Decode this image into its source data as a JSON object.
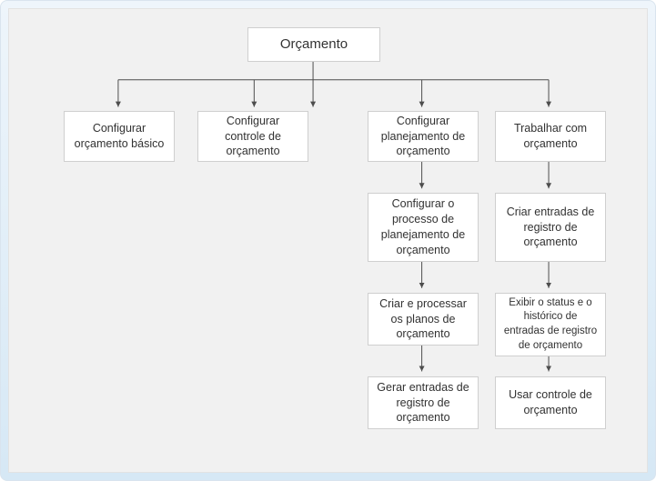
{
  "diagram": {
    "root": {
      "label": "Orçamento"
    },
    "row1": {
      "c1": {
        "label": "Configurar orçamento básico"
      },
      "c2": {
        "label": "Configurar controle de orçamento"
      },
      "c3": {
        "label": "Configurar planejamento de orçamento"
      },
      "c4": {
        "label": "Trabalhar com orçamento"
      }
    },
    "col3": {
      "n1": {
        "label": "Configurar o processo de planejamento de orçamento"
      },
      "n2": {
        "label": "Criar e processar os planos de orçamento"
      },
      "n3": {
        "label": "Gerar entradas de registro de orçamento"
      }
    },
    "col4": {
      "n1": {
        "label": "Criar entradas de registro de orçamento"
      },
      "n2": {
        "label": "Exibir o status e o histórico de entradas de registro de orçamento"
      },
      "n3": {
        "label": "Usar controle de orçamento"
      }
    }
  },
  "style": {
    "stroke": "#4d4d4d"
  }
}
